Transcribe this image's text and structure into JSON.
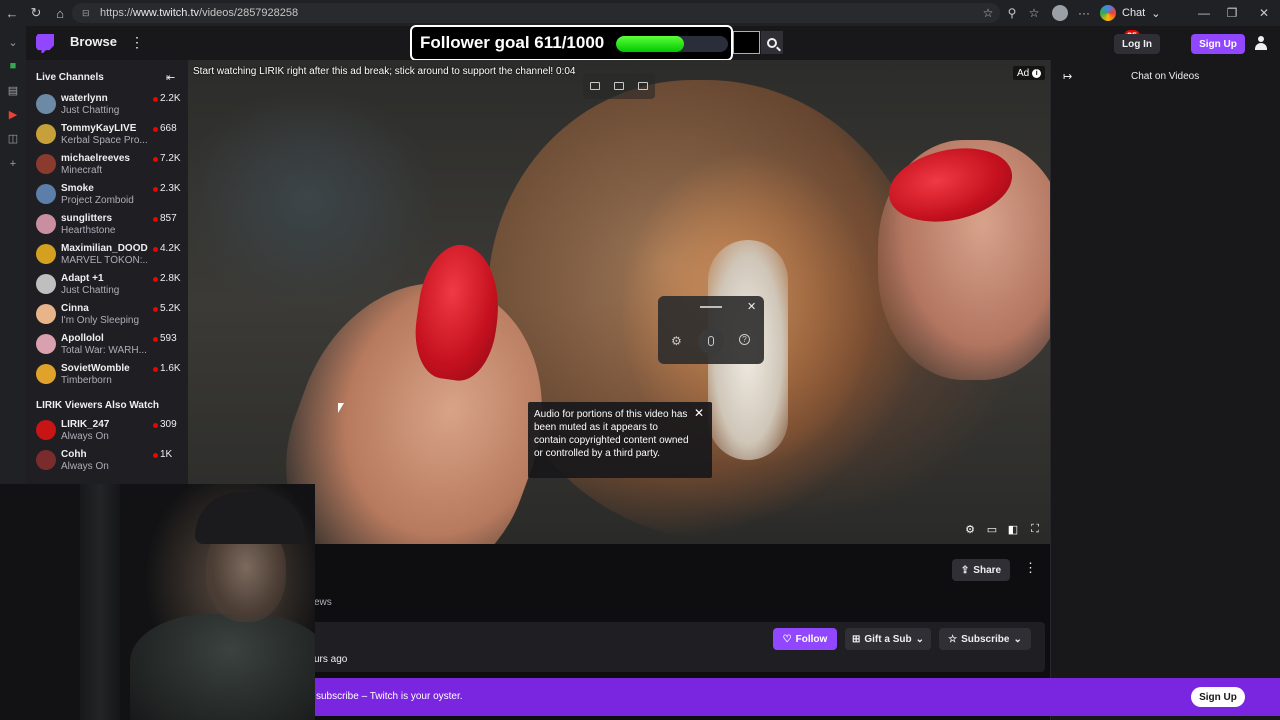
{
  "browser": {
    "url_prefix": "https://",
    "url_host": "www.twitch.tv",
    "url_path": "/videos/2857928258",
    "chat_label": "Chat"
  },
  "nav": {
    "browse_label": "Browse",
    "login_label": "Log In",
    "signup_label": "Sign Up",
    "notification_count": "35"
  },
  "follower_goal": {
    "label": "Follower goal 611/1000",
    "current": 611,
    "target": 1000,
    "fill_color": "#22dd22"
  },
  "sidebar": {
    "live_header": "Live Channels",
    "live_channels": [
      {
        "name": "waterlynn",
        "game": "Just Chatting",
        "viewers": "2.2K",
        "avatar_color": "#6c8aa6"
      },
      {
        "name": "TommyKayLIVE",
        "game": "Kerbal Space Pro...",
        "viewers": "668",
        "avatar_color": "#c7a03a"
      },
      {
        "name": "michaelreeves",
        "game": "Minecraft",
        "viewers": "7.2K",
        "avatar_color": "#8a3b2e"
      },
      {
        "name": "Smoke",
        "game": "Project Zomboid",
        "viewers": "2.3K",
        "avatar_color": "#5b7fa8"
      },
      {
        "name": "sunglitters",
        "game": "Hearthstone",
        "viewers": "857",
        "avatar_color": "#c98fa0"
      },
      {
        "name": "Maximilian_DOOD",
        "game": "MARVEL TŌKON:...",
        "viewers": "4.2K",
        "avatar_color": "#d4a020"
      },
      {
        "name": "Adapt +1",
        "game": "Just Chatting",
        "viewers": "2.8K",
        "avatar_color": "#bfbfbf"
      },
      {
        "name": "Cinna",
        "game": "I'm Only Sleeping",
        "viewers": "5.2K",
        "avatar_color": "#e8b48a"
      },
      {
        "name": "Apollolol",
        "game": "Total War: WARH...",
        "viewers": "593",
        "avatar_color": "#d9a0b0"
      },
      {
        "name": "SovietWomble",
        "game": "Timberborn",
        "viewers": "1.6K",
        "avatar_color": "#e0a22a"
      }
    ],
    "also_watch_header": "LIRIK Viewers Also Watch",
    "also_watch": [
      {
        "name": "LIRIK_247",
        "game": "Always On",
        "viewers": "309",
        "avatar_color": "#c81414"
      },
      {
        "name": "Cohh",
        "game": "Always On",
        "viewers": "1K",
        "avatar_color": "#7a2c2c"
      }
    ]
  },
  "video": {
    "ad_message": "Start watching LIRIK right after this ad break; stick around to support the channel! 0:04",
    "ad_label": "Ad",
    "muted_notice": "Audio for portions of this video has been muted as it appears to contain copyrighted content owned or controlled by a third party."
  },
  "chat": {
    "title": "Chat on Videos"
  },
  "info": {
    "share_label": "Share",
    "views_fragment": "ews",
    "time_fragment": "urs ago",
    "follow_label": "Follow",
    "gift_label": "Gift a Sub",
    "subscribe_label": "Subscribe"
  },
  "banner": {
    "text": "subscribe – Twitch is your oyster.",
    "signup_label": "Sign Up"
  },
  "colors": {
    "twitch_purple": "#9147ff",
    "banner_purple": "#7a25e0",
    "live_red": "#eb0400"
  }
}
